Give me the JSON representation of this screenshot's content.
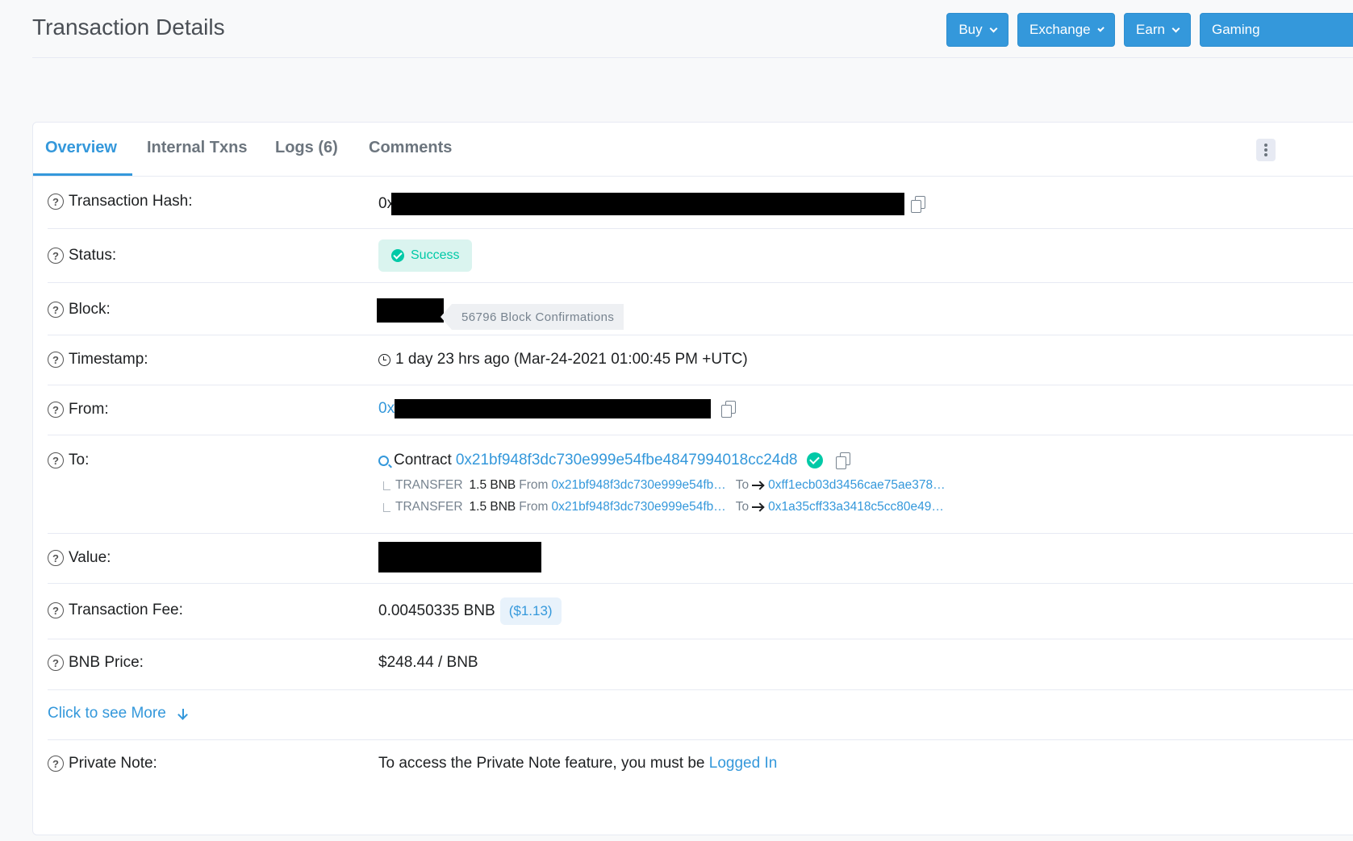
{
  "header": {
    "title": "Transaction Details",
    "buttons": {
      "buy": "Buy",
      "exchange": "Exchange",
      "earn": "Earn",
      "gaming": "Gaming"
    }
  },
  "tabs": {
    "overview": "Overview",
    "internal": "Internal Txns",
    "logs": "Logs (6)",
    "comments": "Comments"
  },
  "fields": {
    "hash": {
      "label": "Transaction Hash:",
      "prefix": "0x"
    },
    "status": {
      "label": "Status:",
      "value": "Success"
    },
    "block": {
      "label": "Block:",
      "confirmations": "56796 Block Confirmations"
    },
    "timestamp": {
      "label": "Timestamp:",
      "value": "1 day 23 hrs ago (Mar-24-2021 01:00:45 PM +UTC)"
    },
    "from": {
      "label": "From:",
      "prefix": "0x"
    },
    "to": {
      "label": "To:",
      "contract_word": "Contract",
      "contract_address": "0x21bf948f3dc730e999e54fbe4847994018cc24d8",
      "transfers": [
        {
          "type": "TRANSFER",
          "amount": "1.5 BNB",
          "from_word": "From",
          "from": "0x21bf948f3dc730e999e54fb…",
          "to_word": "To",
          "to": "0xff1ecb03d3456cae75ae378…"
        },
        {
          "type": "TRANSFER",
          "amount": "1.5 BNB",
          "from_word": "From",
          "from": "0x21bf948f3dc730e999e54fb…",
          "to_word": "To",
          "to": "0x1a35cff33a3418c5cc80e49…"
        }
      ]
    },
    "value": {
      "label": "Value:"
    },
    "fee": {
      "label": "Transaction Fee:",
      "value": "0.00450335 BNB",
      "usd": "($1.13)"
    },
    "price": {
      "label": "BNB Price:",
      "value": "$248.44 / BNB"
    },
    "more": {
      "label": "Click to see More"
    },
    "note": {
      "label": "Private Note:",
      "text": "To access the Private Note feature, you must be ",
      "link": "Logged In"
    }
  },
  "colors": {
    "primary": "#3498db",
    "success": "#00c9a7",
    "text": "#1e2022",
    "muted": "#77838f"
  }
}
